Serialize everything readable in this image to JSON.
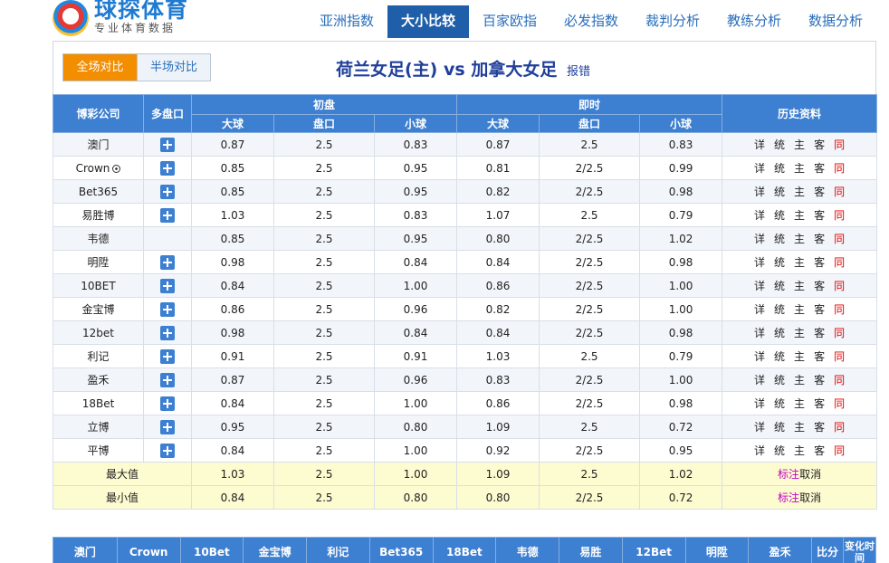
{
  "logo": {
    "title": "球探体育",
    "subtitle": "专业体育数据"
  },
  "nav": [
    {
      "label": "亚洲指数",
      "active": false
    },
    {
      "label": "大小比较",
      "active": true
    },
    {
      "label": "百家欧指",
      "active": false
    },
    {
      "label": "必发指数",
      "active": false
    },
    {
      "label": "裁判分析",
      "active": false
    },
    {
      "label": "教练分析",
      "active": false
    },
    {
      "label": "数据分析",
      "active": false
    }
  ],
  "toggle": {
    "full": "全场对比",
    "half": "半场对比"
  },
  "match": {
    "home": "荷兰女足(主)",
    "vs": "vs",
    "away": "加拿大女足",
    "report": "报错"
  },
  "table": {
    "headers": {
      "company": "博彩公司",
      "multi": "多盘口",
      "initial": "初盘",
      "live": "即时",
      "history": "历史资料",
      "over": "大球",
      "line": "盘口",
      "under": "小球"
    },
    "history_links": [
      "详",
      "统",
      "主",
      "客",
      "同"
    ],
    "rows": [
      {
        "company": "澳门",
        "plus": true,
        "i_over": "0.87",
        "i_line": "2.5",
        "i_under": "0.83",
        "l_over": "0.87",
        "l_line": "2.5",
        "l_under": "0.83"
      },
      {
        "company": "Crown",
        "ball": true,
        "plus": true,
        "i_over": "0.85",
        "i_line": "2.5",
        "i_under": "0.95",
        "l_over": "0.81",
        "l_line": "2/2.5",
        "l_under": "0.99"
      },
      {
        "company": "Bet365",
        "plus": true,
        "i_over": "0.85",
        "i_line": "2.5",
        "i_under": "0.95",
        "l_over": "0.82",
        "l_line": "2/2.5",
        "l_under": "0.98"
      },
      {
        "company": "易胜博",
        "plus": true,
        "i_over": "1.03",
        "i_line": "2.5",
        "i_under": "0.83",
        "l_over": "1.07",
        "l_line": "2.5",
        "l_under": "0.79"
      },
      {
        "company": "韦德",
        "plus": false,
        "i_over": "0.85",
        "i_line": "2.5",
        "i_under": "0.95",
        "l_over": "0.80",
        "l_line": "2/2.5",
        "l_under": "1.02"
      },
      {
        "company": "明陞",
        "plus": true,
        "i_over": "0.98",
        "i_line": "2.5",
        "i_under": "0.84",
        "l_over": "0.84",
        "l_line": "2/2.5",
        "l_under": "0.98"
      },
      {
        "company": "10BET",
        "plus": true,
        "i_over": "0.84",
        "i_line": "2.5",
        "i_under": "1.00",
        "l_over": "0.86",
        "l_line": "2/2.5",
        "l_under": "1.00"
      },
      {
        "company": "金宝博",
        "plus": true,
        "i_over": "0.86",
        "i_line": "2.5",
        "i_under": "0.96",
        "l_over": "0.82",
        "l_line": "2/2.5",
        "l_under": "1.00"
      },
      {
        "company": "12bet",
        "plus": true,
        "i_over": "0.98",
        "i_line": "2.5",
        "i_under": "0.84",
        "l_over": "0.84",
        "l_line": "2/2.5",
        "l_under": "0.98"
      },
      {
        "company": "利记",
        "plus": true,
        "i_over": "0.91",
        "i_line": "2.5",
        "i_under": "0.91",
        "l_over": "1.03",
        "l_line": "2.5",
        "l_under": "0.79"
      },
      {
        "company": "盈禾",
        "plus": true,
        "i_over": "0.87",
        "i_line": "2.5",
        "i_under": "0.96",
        "l_over": "0.83",
        "l_line": "2/2.5",
        "l_under": "1.00"
      },
      {
        "company": "18Bet",
        "plus": true,
        "i_over": "0.84",
        "i_line": "2.5",
        "i_under": "1.00",
        "l_over": "0.86",
        "l_line": "2/2.5",
        "l_under": "0.98"
      },
      {
        "company": "立博",
        "plus": true,
        "i_over": "0.95",
        "i_line": "2.5",
        "i_under": "0.80",
        "l_over": "1.09",
        "l_line": "2.5",
        "l_under": "0.72"
      },
      {
        "company": "平博",
        "plus": true,
        "i_over": "0.84",
        "i_line": "2.5",
        "i_under": "1.00",
        "l_over": "0.92",
        "l_line": "2/2.5",
        "l_under": "0.95"
      }
    ],
    "summary": [
      {
        "label": "最大值",
        "i_over": "1.03",
        "i_line": "2.5",
        "i_under": "1.00",
        "l_over": "1.09",
        "l_line": "2.5",
        "l_under": "1.02",
        "mark": "标注",
        "cancel": "取消"
      },
      {
        "label": "最小值",
        "i_over": "0.84",
        "i_line": "2.5",
        "i_under": "0.80",
        "l_over": "0.80",
        "l_line": "2/2.5",
        "l_under": "0.72",
        "mark": "标注",
        "cancel": "取消"
      }
    ]
  },
  "bottom_headers": [
    "澳门",
    "Crown",
    "10Bet",
    "金宝博",
    "利记",
    "Bet365",
    "18Bet",
    "韦德",
    "易胜",
    "12Bet",
    "明陞",
    "盈禾",
    "比分",
    "变化时间"
  ],
  "colors": {
    "header_blue": "#3d7fd0",
    "active_nav": "#1f5ea8",
    "toggle_orange": "#f28e00",
    "summary_yellow": "#fdfbd0"
  }
}
